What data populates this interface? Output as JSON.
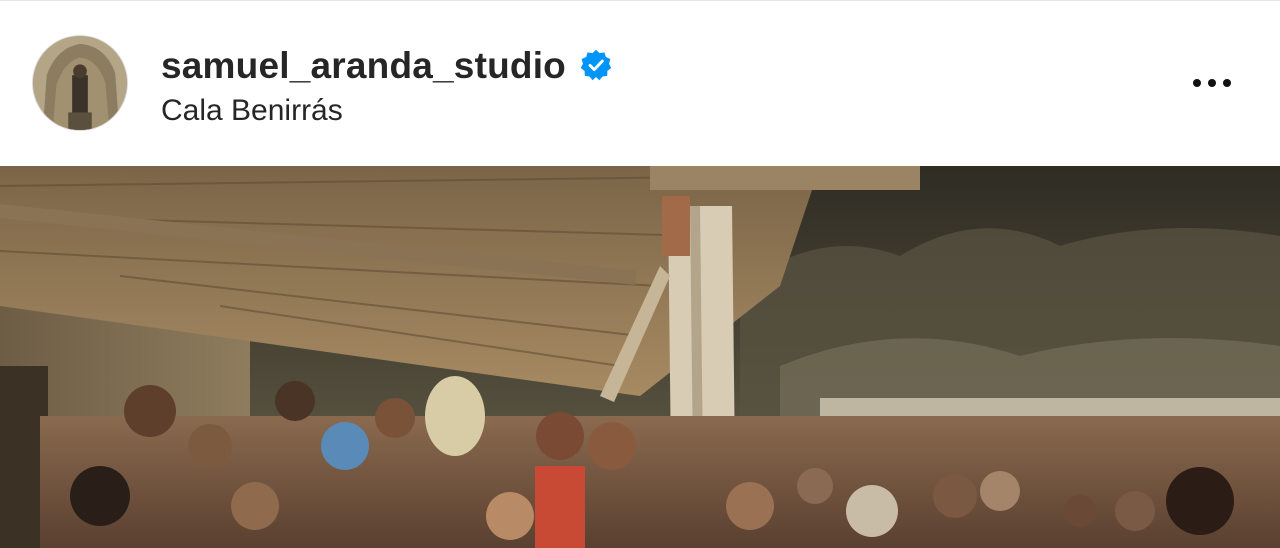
{
  "post": {
    "author": {
      "username": "samuel_aranda_studio",
      "verified": true,
      "avatar_icon": "profile-photo",
      "verified_color": "#0095f6"
    },
    "location": "Cala Benirrás",
    "more_icon": "more-horizontal-icon",
    "image": {
      "description_icon": "beach-party-photo"
    }
  }
}
